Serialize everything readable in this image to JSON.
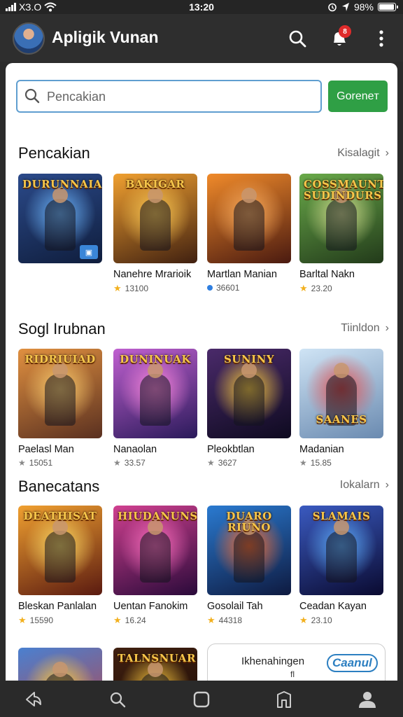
{
  "status_bar": {
    "carrier": "ХЗ.О",
    "time": "13:20",
    "battery": "98%",
    "icons": [
      "signal-icon",
      "wifi-icon",
      "alarm-icon",
      "location-icon",
      "battery-icon"
    ]
  },
  "app_bar": {
    "title": "Apligik Vunan",
    "notification_count": "8",
    "icons": [
      "avatar",
      "search-icon",
      "notification-bell-icon",
      "more-vert-icon"
    ]
  },
  "search": {
    "placeholder": "Pencakian",
    "button_label": "Goreneт"
  },
  "sections": [
    {
      "title": "Pencakian",
      "see_all": "Kisalagit",
      "cards": [
        {
          "name": "",
          "art_title": "DURUNNAIA",
          "rating": "",
          "gradient": [
            "#2b4a8a",
            "#0f1d3c"
          ],
          "accent": "#6fb8ff",
          "corner": true
        },
        {
          "name": "Nanehre Mrarioik",
          "art_title": "BAKIGAR",
          "rating": "13100",
          "gradient": [
            "#f0a030",
            "#402010"
          ],
          "accent": "#ffcc55"
        },
        {
          "name": "Martlan Manian",
          "art_title": "",
          "rating": "36601",
          "gradient": [
            "#f08a2a",
            "#4a1a10"
          ],
          "accent": "#ffb060",
          "rating_dot": true
        },
        {
          "name": "Barltal Nakn",
          "art_title": "COSSMAUNT SUDINDURS",
          "rating": "23.20",
          "gradient": [
            "#6aaa4a",
            "#223a1a"
          ],
          "accent": "#d4e090"
        }
      ]
    },
    {
      "title": "Sogl Irubnan",
      "see_all": "Tiinldon",
      "cards": [
        {
          "name": "Paelasl Man",
          "art_title": "RIDRIUIAD",
          "rating": "15051",
          "gradient": [
            "#e09040",
            "#5a3020"
          ],
          "accent": "#ffd070"
        },
        {
          "name": "Nanaolan",
          "art_title": "DUNINUAK",
          "rating": "33.57",
          "gradient": [
            "#c060d0",
            "#2a1a5a"
          ],
          "accent": "#ff8ae0"
        },
        {
          "name": "Pleokbtlan",
          "art_title": "SUNINY",
          "rating": "3627",
          "gradient": [
            "#4a2a6a",
            "#0e0a20"
          ],
          "accent": "#ffd040"
        },
        {
          "name": "Madanian",
          "art_title": "SAANES",
          "rating": "15.85",
          "gradient": [
            "#cfe4f5",
            "#6a8ab0"
          ],
          "accent": "#e05050"
        }
      ]
    },
    {
      "title": "Banecatans",
      "see_all": "Iokalarn",
      "cards": [
        {
          "name": "Bleskan Panlalan",
          "art_title": "DEATHISAT",
          "rating": "15590",
          "gradient": [
            "#f0a030",
            "#5a1a10"
          ],
          "accent": "#ffdd66"
        },
        {
          "name": "Uentan Fanokim",
          "art_title": "HIUDANUNS",
          "rating": "16.24",
          "gradient": [
            "#d04090",
            "#2a0a3a"
          ],
          "accent": "#ff70c0"
        },
        {
          "name": "Gosolail Tah",
          "art_title": "DUARO RIUNO",
          "rating": "44318",
          "gradient": [
            "#2a7ad0",
            "#0e1a40"
          ],
          "accent": "#ff7030"
        },
        {
          "name": "Ceadan Kayan",
          "art_title": "SLAMAIS",
          "rating": "23.10",
          "gradient": [
            "#3a5ac0",
            "#0a0a30"
          ],
          "accent": "#60b0ff"
        }
      ]
    },
    {
      "title": "",
      "see_all": "",
      "cards": [
        {
          "name": "",
          "art_title": "",
          "rating": "",
          "gradient": [
            "#4a80d0",
            "#c04040"
          ],
          "accent": "#ffd040"
        },
        {
          "name": "",
          "art_title": "TALNSNUAR",
          "rating": "",
          "gradient": [
            "#402010",
            "#1a0a05"
          ],
          "accent": "#ffcc40"
        }
      ]
    }
  ],
  "promo": {
    "text": "Ikhenahingen",
    "sub": "fl",
    "button": "Caanul"
  },
  "bottom_nav": [
    "back-icon",
    "search-icon",
    "home-square-icon",
    "library-icon",
    "profile-icon"
  ]
}
